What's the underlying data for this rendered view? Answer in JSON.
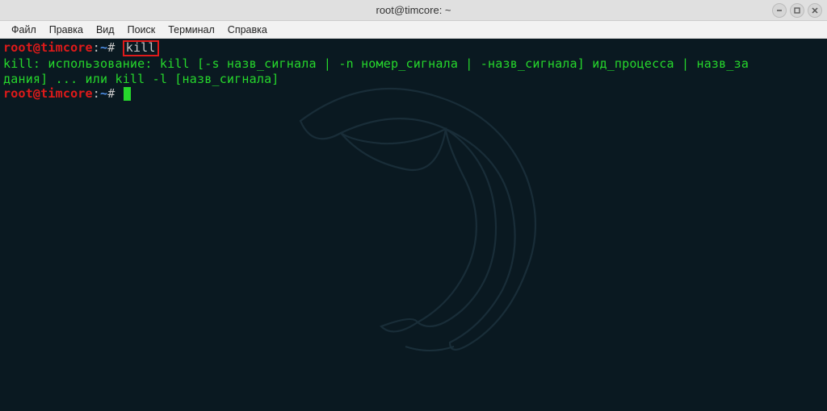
{
  "window": {
    "title": "root@timcore: ~"
  },
  "menu": {
    "file": "Файл",
    "edit": "Правка",
    "view": "Вид",
    "search": "Поиск",
    "terminal": "Терминал",
    "help": "Справка"
  },
  "terminal": {
    "prompt_user": "root@timcore",
    "prompt_colon": ":",
    "prompt_path": "~",
    "prompt_hash": "#",
    "line1_cmd_highlight": "kill",
    "output_line1": "kill: использование: kill [-s назв_сигнала | -n номер_сигнала | -назв_сигнала] ид_процесса | назв_за",
    "output_line2": "дания] ... или kill -l [назв_сигнала]"
  }
}
